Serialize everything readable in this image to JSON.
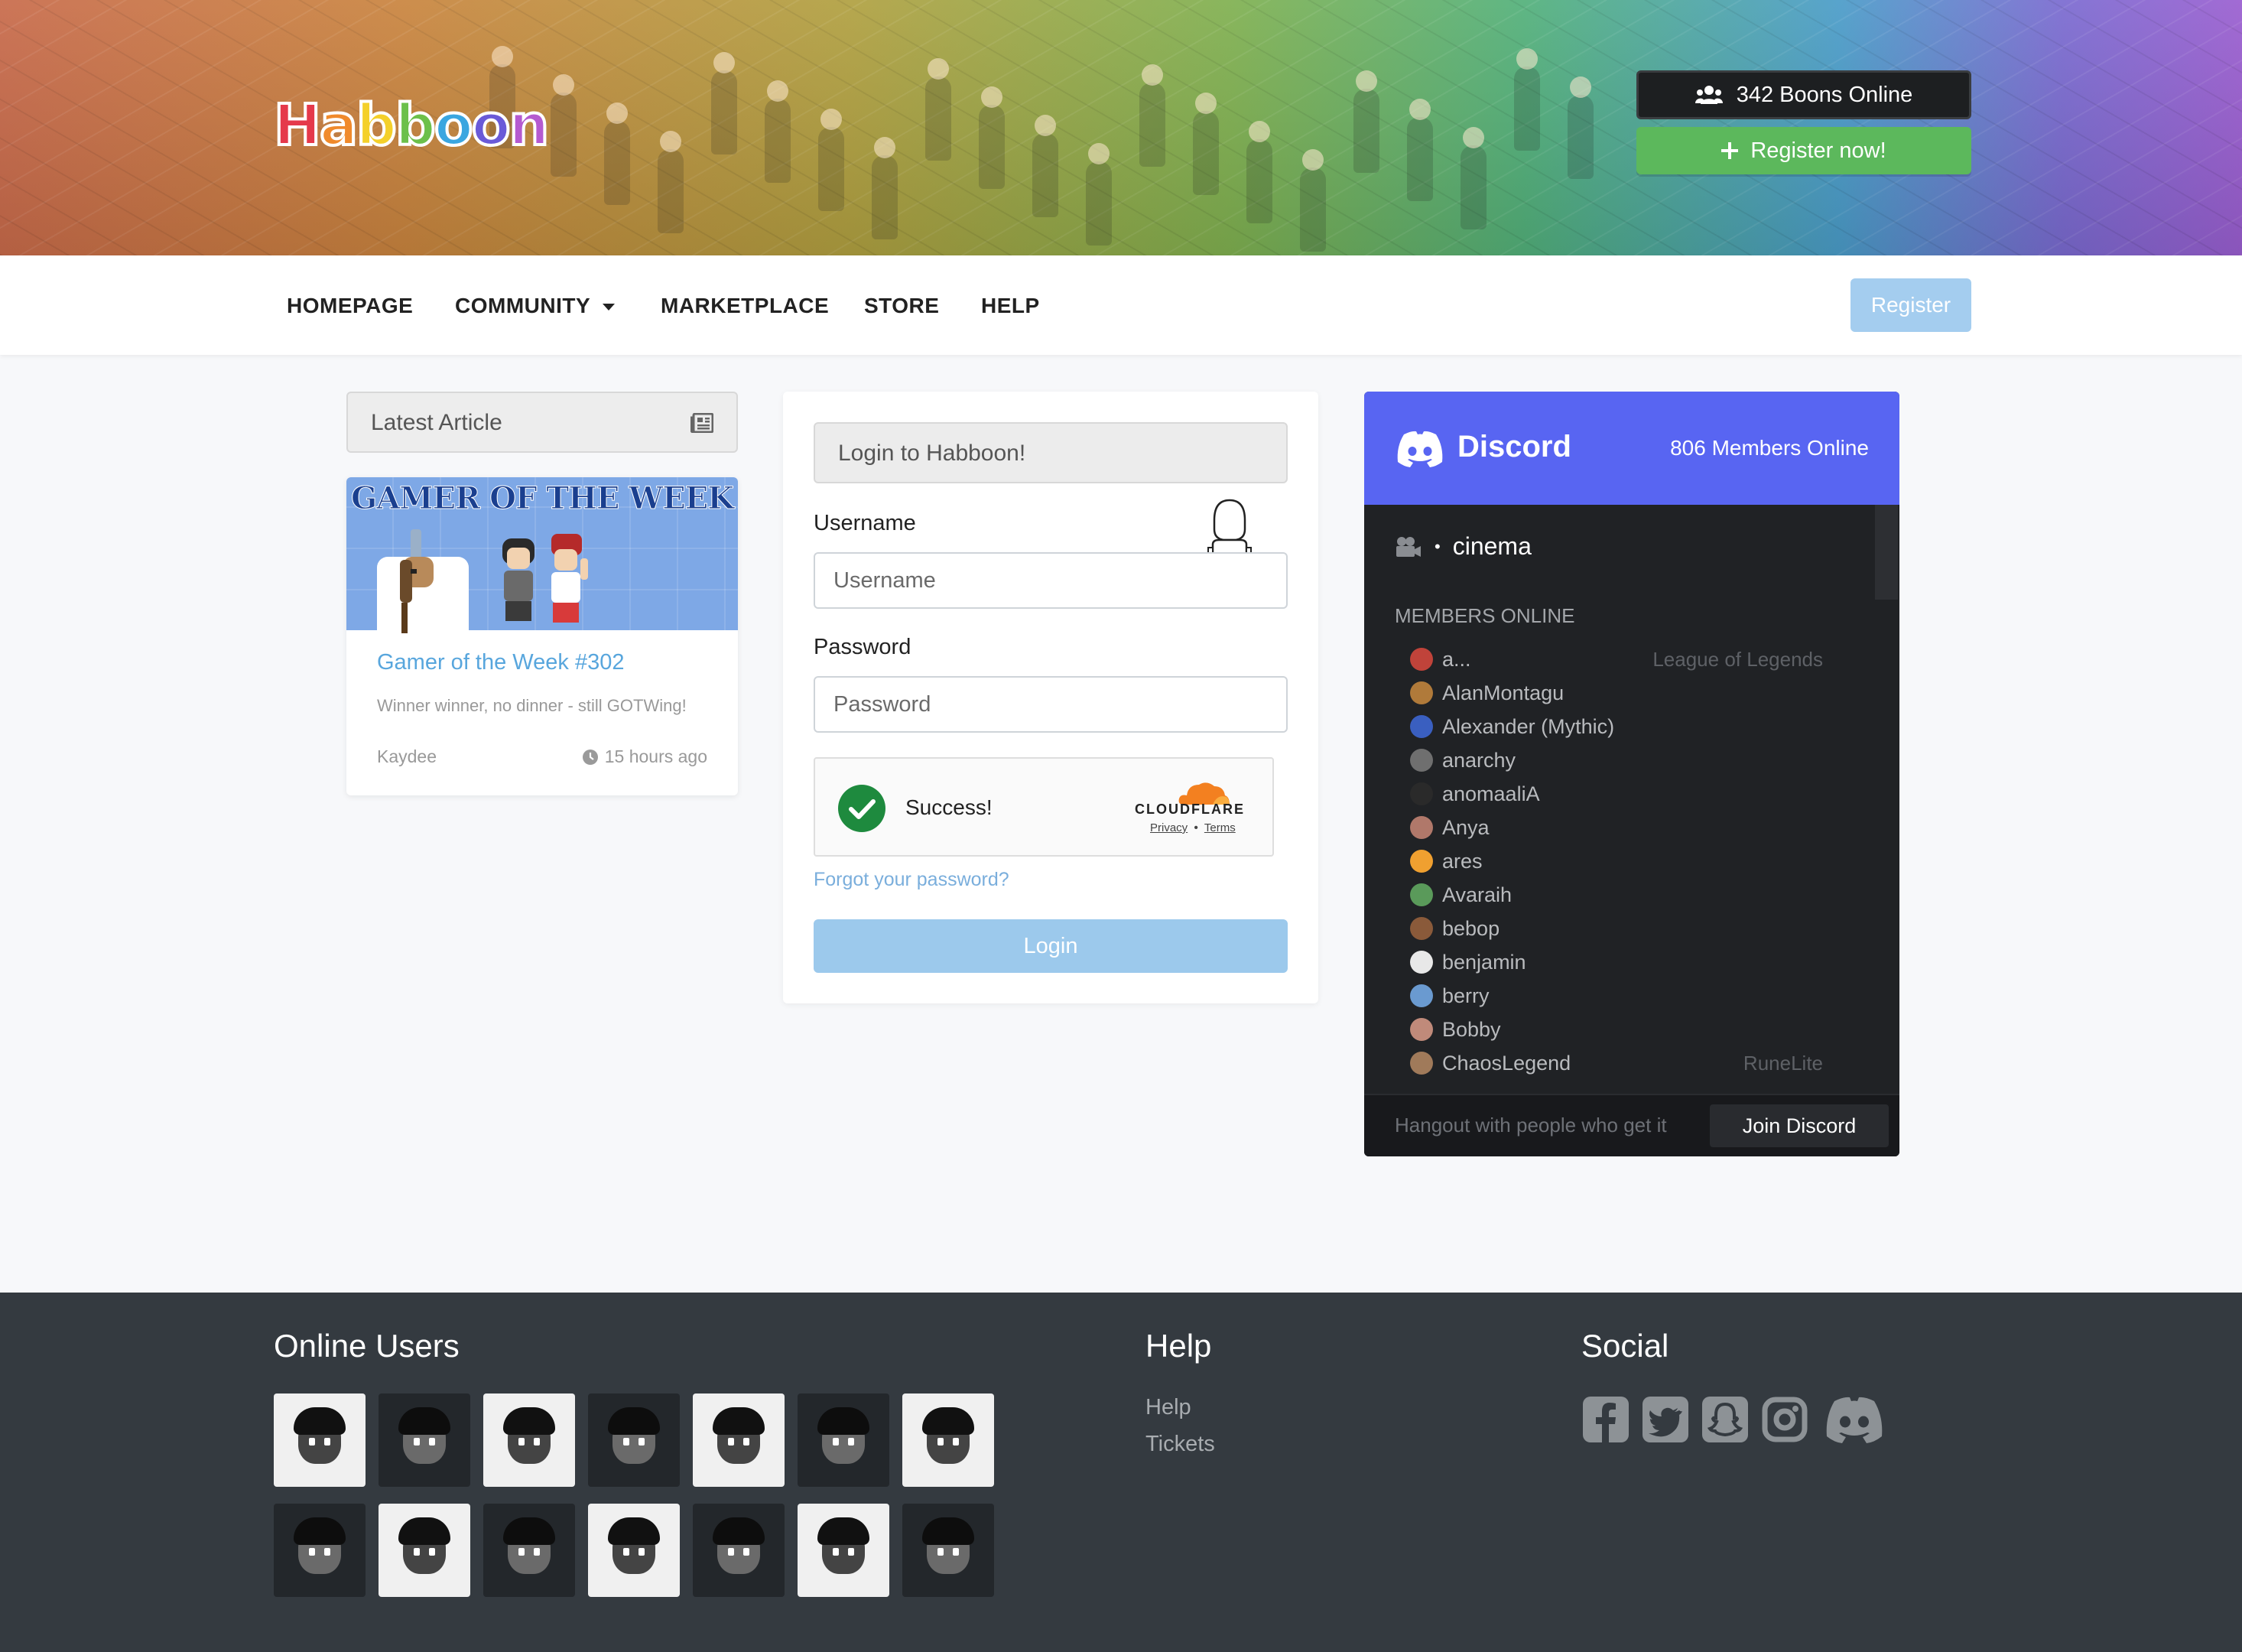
{
  "hero": {
    "logo_text": "Habboon",
    "logo_letters": [
      "H",
      "a",
      "b",
      "b",
      "o",
      "o",
      "n"
    ],
    "logo_colors": [
      "#e5394b",
      "#f08a2c",
      "#f4d02a",
      "#6cc04a",
      "#3aa6e0",
      "#6a5ad8",
      "#b55ad0"
    ],
    "boons_online_label": "342 Boons Online",
    "register_now_label": "Register now!",
    "people_icon": "users-icon",
    "plus_icon": "plus-icon"
  },
  "nav": {
    "items": [
      {
        "label": "HOMEPAGE"
      },
      {
        "label": "COMMUNITY",
        "has_caret": true
      },
      {
        "label": "MARKETPLACE"
      },
      {
        "label": "STORE"
      },
      {
        "label": "HELP"
      }
    ],
    "register_label": "Register"
  },
  "article": {
    "header": "Latest Article",
    "header_icon": "newspaper-icon",
    "banner_text": "GAMER OF THE WEEK",
    "title": "Gamer of the Week #302",
    "description": "Winner winner, no dinner - still GOTWing!",
    "author": "Kaydee",
    "time": "15 hours ago",
    "time_icon": "clock-icon"
  },
  "login": {
    "header": "Login to Habboon!",
    "username_label": "Username",
    "username_placeholder": "Username",
    "password_label": "Password",
    "password_placeholder": "Password",
    "captcha_status": "Success!",
    "captcha_brand": "CLOUDFLARE",
    "captcha_privacy": "Privacy",
    "captcha_separator": "•",
    "captcha_terms": "Terms",
    "forgot_label": "Forgot your password?",
    "login_label": "Login"
  },
  "discord": {
    "brand": "Discord",
    "members_online": "806 Members Online",
    "channel_prefix": "•",
    "channel": "cinema",
    "members_heading": "MEMBERS ONLINE",
    "members": [
      {
        "name": "a...",
        "game": "League of Legends",
        "color": "#c0433a"
      },
      {
        "name": "AlanMontagu",
        "game": "",
        "color": "#b07a3a"
      },
      {
        "name": "Alexander (Mythic)",
        "game": "",
        "color": "#3a5fc0"
      },
      {
        "name": "anarchy",
        "game": "",
        "color": "#6f6f6f"
      },
      {
        "name": "anomaaliA",
        "game": "",
        "color": "#2a2a2a"
      },
      {
        "name": "Anya",
        "game": "",
        "color": "#b0786a"
      },
      {
        "name": "ares",
        "game": "",
        "color": "#f0a030"
      },
      {
        "name": "Avaraih",
        "game": "",
        "color": "#5a9a5a"
      },
      {
        "name": "bebop",
        "game": "",
        "color": "#8a5a3a"
      },
      {
        "name": "benjamin",
        "game": "",
        "color": "#e8e8e8"
      },
      {
        "name": "berry",
        "game": "",
        "color": "#6a9ad0"
      },
      {
        "name": "Bobby",
        "game": "",
        "color": "#c08a7a"
      },
      {
        "name": "ChaosLegend",
        "game": "RuneLite",
        "color": "#a07a5a"
      }
    ],
    "tagline": "Hangout with people who get it",
    "join_label": "Join Discord",
    "accent": "#5865f2"
  },
  "footer": {
    "online_users_heading": "Online Users",
    "help_heading": "Help",
    "help_links": [
      "Help",
      "Tickets"
    ],
    "social_heading": "Social",
    "social_icons": [
      "facebook-icon",
      "twitter-icon",
      "snapchat-icon",
      "instagram-icon",
      "discord-icon"
    ],
    "avatar_tiles": [
      "light",
      "dark",
      "light",
      "dark",
      "light",
      "dark",
      "light",
      "dark",
      "light",
      "dark",
      "light",
      "dark",
      "light",
      "dark"
    ]
  }
}
